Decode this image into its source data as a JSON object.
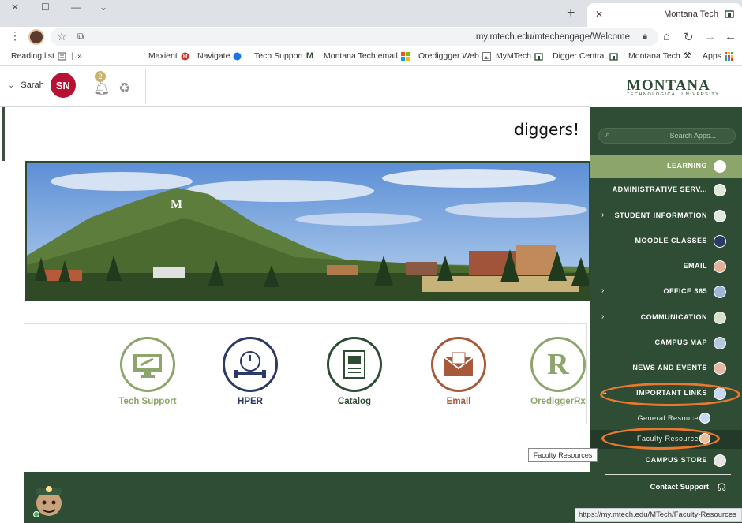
{
  "browser": {
    "tab_title": "Montana Tech",
    "url": "my.mtech.edu/mtechengage/Welcome",
    "bookmarks": [
      {
        "label": "Apps",
        "icon": "apps-grid-icon"
      },
      {
        "label": "Montana Tech",
        "icon": "pickaxe-icon"
      },
      {
        "label": "Digger Central",
        "icon": "building-icon"
      },
      {
        "label": "MyMTech",
        "icon": "building-icon"
      },
      {
        "label": "Orediggger Web",
        "icon": "image-icon"
      },
      {
        "label": "Montana Tech email",
        "icon": "microsoft-icon"
      },
      {
        "label": "Tech Support",
        "icon": "m-logo-icon"
      },
      {
        "label": "Navigate",
        "icon": "navigate-icon"
      },
      {
        "label": "Maxient",
        "icon": "maxient-icon"
      },
      {
        "label": "»",
        "icon": ""
      },
      {
        "label": "Reading list",
        "icon": "reading-list-icon"
      }
    ]
  },
  "header": {
    "user_name": "Sarah",
    "user_initials": "SN",
    "badge_count": "2"
  },
  "main": {
    "greeting": "diggers!",
    "apps": [
      {
        "label": "OrediggerRx",
        "color": "#8ba56a"
      },
      {
        "label": "Email",
        "color": "#a65a3a"
      },
      {
        "label": "Catalog",
        "color": "#2e4d34"
      },
      {
        "label": "HPER",
        "color": "#2b3a66"
      },
      {
        "label": "Tech Support",
        "color": "#8ba56a"
      }
    ]
  },
  "sidebar": {
    "logo": "MONTANA",
    "logo_sub": "TECHNOLOGICAL UNIVERSITY",
    "search_placeholder": "Search Apps...",
    "items": [
      {
        "label": "LEARNING",
        "active": true
      },
      {
        "label": "ADMINISTRATIVE SERV..."
      },
      {
        "label": "STUDENT INFORMATION",
        "arrow": "›"
      },
      {
        "label": "MOODLE CLASSES"
      },
      {
        "label": "EMAIL"
      },
      {
        "label": "OFFICE 365",
        "arrow": "›"
      },
      {
        "label": "COMMUNICATION",
        "arrow": "›"
      },
      {
        "label": "CAMPUS MAP"
      },
      {
        "label": "NEWS AND EVENTS"
      },
      {
        "label": "IMPORTANT LINKS",
        "arrow": "⌄"
      },
      {
        "label": "CAMPUS STORE"
      }
    ],
    "sub_items": [
      {
        "label": "General Resouces"
      },
      {
        "label": "Faculty Resources"
      }
    ],
    "contact": "Contact Support"
  },
  "tooltip": "Faculty Resources",
  "status_url": "https://my.mtech.edu/MTech/Faculty-Resources",
  "colors": {
    "brand_green": "#2e4d34",
    "accent_green": "#8ba56a",
    "brand_red": "#b71234",
    "highlight_orange": "#e8792f"
  }
}
